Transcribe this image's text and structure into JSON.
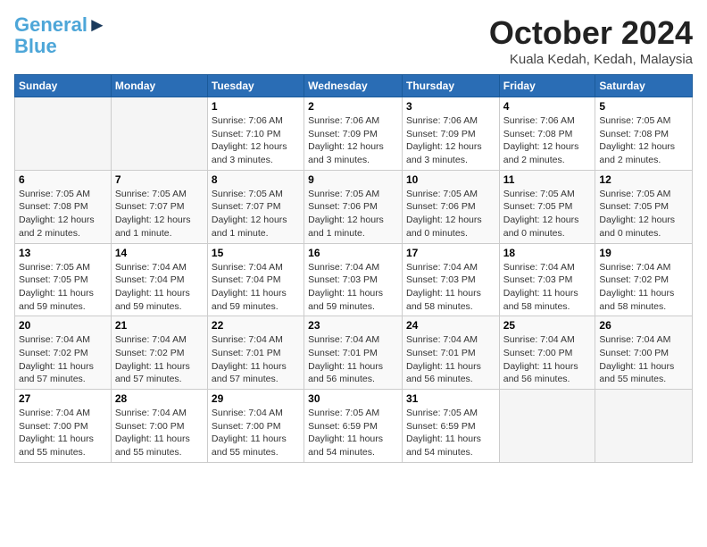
{
  "logo": {
    "line1": "General",
    "line2": "Blue"
  },
  "title": "October 2024",
  "location": "Kuala Kedah, Kedah, Malaysia",
  "headers": [
    "Sunday",
    "Monday",
    "Tuesday",
    "Wednesday",
    "Thursday",
    "Friday",
    "Saturday"
  ],
  "weeks": [
    [
      {
        "day": "",
        "info": ""
      },
      {
        "day": "",
        "info": ""
      },
      {
        "day": "1",
        "info": "Sunrise: 7:06 AM\nSunset: 7:10 PM\nDaylight: 12 hours and 3 minutes."
      },
      {
        "day": "2",
        "info": "Sunrise: 7:06 AM\nSunset: 7:09 PM\nDaylight: 12 hours and 3 minutes."
      },
      {
        "day": "3",
        "info": "Sunrise: 7:06 AM\nSunset: 7:09 PM\nDaylight: 12 hours and 3 minutes."
      },
      {
        "day": "4",
        "info": "Sunrise: 7:06 AM\nSunset: 7:08 PM\nDaylight: 12 hours and 2 minutes."
      },
      {
        "day": "5",
        "info": "Sunrise: 7:05 AM\nSunset: 7:08 PM\nDaylight: 12 hours and 2 minutes."
      }
    ],
    [
      {
        "day": "6",
        "info": "Sunrise: 7:05 AM\nSunset: 7:08 PM\nDaylight: 12 hours and 2 minutes."
      },
      {
        "day": "7",
        "info": "Sunrise: 7:05 AM\nSunset: 7:07 PM\nDaylight: 12 hours and 1 minute."
      },
      {
        "day": "8",
        "info": "Sunrise: 7:05 AM\nSunset: 7:07 PM\nDaylight: 12 hours and 1 minute."
      },
      {
        "day": "9",
        "info": "Sunrise: 7:05 AM\nSunset: 7:06 PM\nDaylight: 12 hours and 1 minute."
      },
      {
        "day": "10",
        "info": "Sunrise: 7:05 AM\nSunset: 7:06 PM\nDaylight: 12 hours and 0 minutes."
      },
      {
        "day": "11",
        "info": "Sunrise: 7:05 AM\nSunset: 7:05 PM\nDaylight: 12 hours and 0 minutes."
      },
      {
        "day": "12",
        "info": "Sunrise: 7:05 AM\nSunset: 7:05 PM\nDaylight: 12 hours and 0 minutes."
      }
    ],
    [
      {
        "day": "13",
        "info": "Sunrise: 7:05 AM\nSunset: 7:05 PM\nDaylight: 11 hours and 59 minutes."
      },
      {
        "day": "14",
        "info": "Sunrise: 7:04 AM\nSunset: 7:04 PM\nDaylight: 11 hours and 59 minutes."
      },
      {
        "day": "15",
        "info": "Sunrise: 7:04 AM\nSunset: 7:04 PM\nDaylight: 11 hours and 59 minutes."
      },
      {
        "day": "16",
        "info": "Sunrise: 7:04 AM\nSunset: 7:03 PM\nDaylight: 11 hours and 59 minutes."
      },
      {
        "day": "17",
        "info": "Sunrise: 7:04 AM\nSunset: 7:03 PM\nDaylight: 11 hours and 58 minutes."
      },
      {
        "day": "18",
        "info": "Sunrise: 7:04 AM\nSunset: 7:03 PM\nDaylight: 11 hours and 58 minutes."
      },
      {
        "day": "19",
        "info": "Sunrise: 7:04 AM\nSunset: 7:02 PM\nDaylight: 11 hours and 58 minutes."
      }
    ],
    [
      {
        "day": "20",
        "info": "Sunrise: 7:04 AM\nSunset: 7:02 PM\nDaylight: 11 hours and 57 minutes."
      },
      {
        "day": "21",
        "info": "Sunrise: 7:04 AM\nSunset: 7:02 PM\nDaylight: 11 hours and 57 minutes."
      },
      {
        "day": "22",
        "info": "Sunrise: 7:04 AM\nSunset: 7:01 PM\nDaylight: 11 hours and 57 minutes."
      },
      {
        "day": "23",
        "info": "Sunrise: 7:04 AM\nSunset: 7:01 PM\nDaylight: 11 hours and 56 minutes."
      },
      {
        "day": "24",
        "info": "Sunrise: 7:04 AM\nSunset: 7:01 PM\nDaylight: 11 hours and 56 minutes."
      },
      {
        "day": "25",
        "info": "Sunrise: 7:04 AM\nSunset: 7:00 PM\nDaylight: 11 hours and 56 minutes."
      },
      {
        "day": "26",
        "info": "Sunrise: 7:04 AM\nSunset: 7:00 PM\nDaylight: 11 hours and 55 minutes."
      }
    ],
    [
      {
        "day": "27",
        "info": "Sunrise: 7:04 AM\nSunset: 7:00 PM\nDaylight: 11 hours and 55 minutes."
      },
      {
        "day": "28",
        "info": "Sunrise: 7:04 AM\nSunset: 7:00 PM\nDaylight: 11 hours and 55 minutes."
      },
      {
        "day": "29",
        "info": "Sunrise: 7:04 AM\nSunset: 7:00 PM\nDaylight: 11 hours and 55 minutes."
      },
      {
        "day": "30",
        "info": "Sunrise: 7:05 AM\nSunset: 6:59 PM\nDaylight: 11 hours and 54 minutes."
      },
      {
        "day": "31",
        "info": "Sunrise: 7:05 AM\nSunset: 6:59 PM\nDaylight: 11 hours and 54 minutes."
      },
      {
        "day": "",
        "info": ""
      },
      {
        "day": "",
        "info": ""
      }
    ]
  ]
}
